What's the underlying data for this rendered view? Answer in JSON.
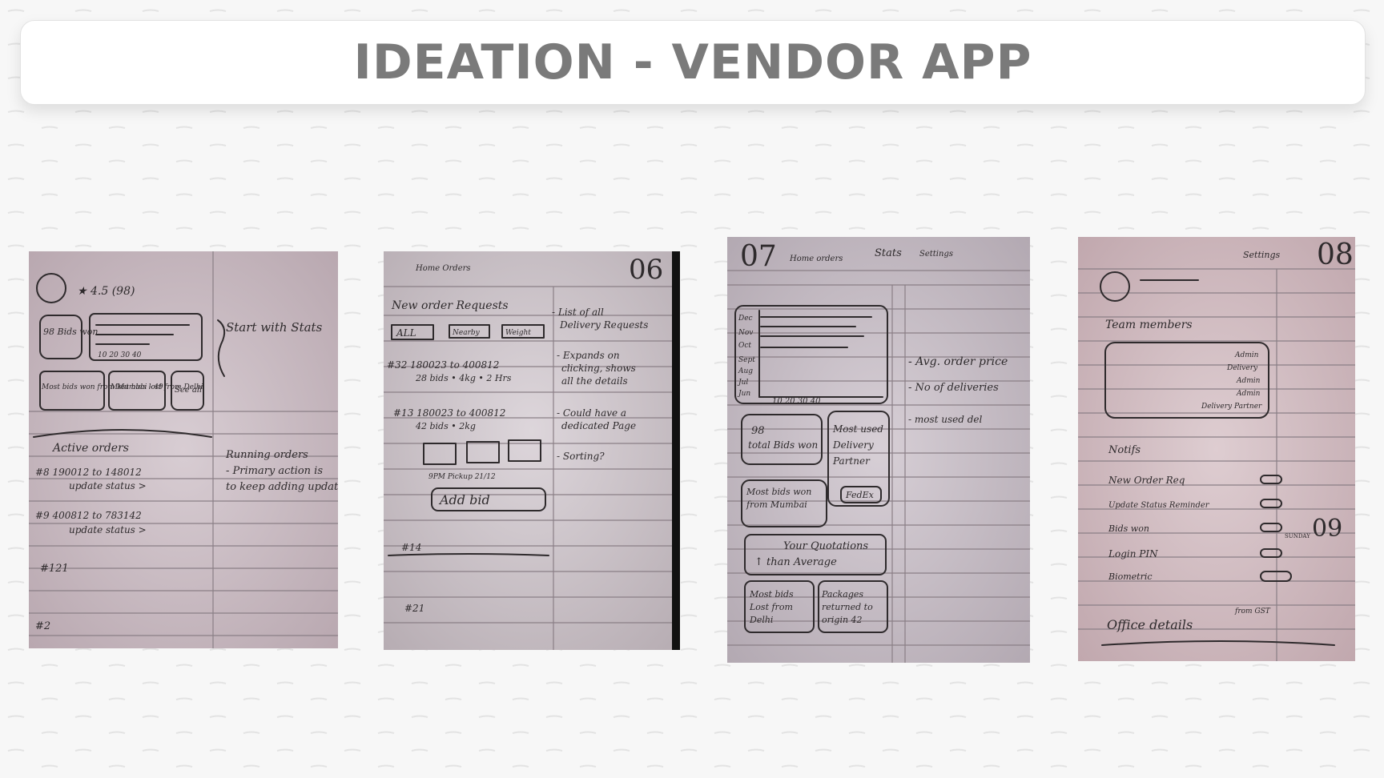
{
  "header": {
    "title": "IDEATION - VENDOR APP"
  },
  "sketches": [
    {
      "page_label": "",
      "lines": [
        "★ 4.5 (98)",
        "98 Bids won",
        "10  20  30  40",
        "Start with Stats",
        "Most bids won from Mumbai - 49",
        "Most bids lost from Delhi",
        "See all",
        "Active orders",
        "#8  190012 to 148012",
        "update status >",
        "#9  400812 to 783142",
        "update status >",
        "Running orders - Primary action is to keep adding updates.",
        "#121",
        "#2"
      ]
    },
    {
      "page_label": "06",
      "lines": [
        "Home  Orders",
        "New order Requests",
        "ALL",
        "Nearby",
        "Weight",
        "- List of all Delivery Requests",
        "#32 180023 to 400812",
        "28 bids • 4kg • 2 Hrs",
        "- Expands on clicking, shows all the details",
        "#13 180023 to 400812",
        "42 bids • 2kg",
        "- Could have a dedicated Page",
        "- Sorting?",
        "9PM Pickup  21/12",
        "Add bid",
        "#14",
        "#21"
      ]
    },
    {
      "page_label": "07",
      "lines": [
        "Home  orders  Stats  Settings",
        "Dec",
        "Nov",
        "Oct",
        "Sept",
        "Aug",
        "Jul",
        "Jun",
        "10  20  30  40",
        "- Avg. order price",
        "- No of deliveries",
        "- most used del",
        "98 total Bids won",
        "Most used Delivery Partner",
        "FedEx",
        "Most bids won from Mumbai",
        "Your Quotations",
        "↑ than Average",
        "Most bids Lost from Delhi",
        "Packages returned to origin 42"
      ]
    },
    {
      "page_label": "08",
      "lines": [
        "Settings",
        "Team members",
        "Admin",
        "Delivery",
        "Admin",
        "Admin",
        "Delivery Partner",
        "Notifs",
        "New Order Req",
        "Update Status Reminder",
        "Bids won",
        "Login PIN",
        "Biometric",
        "Office details",
        "from GST",
        "09",
        "SUNDAY"
      ]
    }
  ],
  "colors": {
    "title": "#7a7a7a",
    "paper": "#d9cdd3",
    "ink": "#2e2a2c"
  }
}
